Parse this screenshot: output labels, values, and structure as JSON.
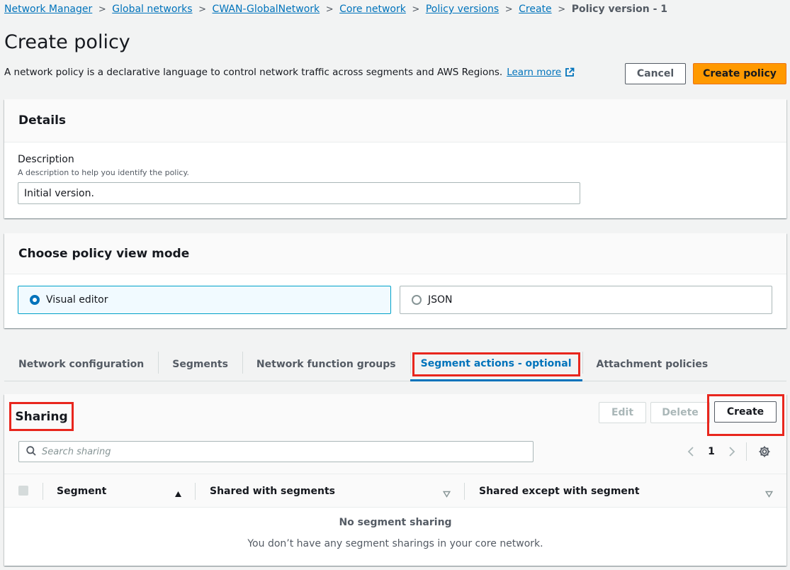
{
  "breadcrumb": {
    "items": [
      "Network Manager",
      "Global networks",
      "CWAN-GlobalNetwork",
      "Core network",
      "Policy versions",
      "Create"
    ],
    "current": "Policy version - 1"
  },
  "header": {
    "title": "Create policy",
    "description": "A network policy is a declarative language to control network traffic across segments and AWS Regions.",
    "learn_more": "Learn more",
    "cancel_label": "Cancel",
    "create_label": "Create policy"
  },
  "details": {
    "title": "Details",
    "description_label": "Description",
    "description_hint": "A description to help you identify the policy.",
    "description_value": "Initial version."
  },
  "view_mode": {
    "title": "Choose policy view mode",
    "options": [
      {
        "label": "Visual editor",
        "selected": true
      },
      {
        "label": "JSON",
        "selected": false
      }
    ]
  },
  "tabs": [
    {
      "label": "Network configuration",
      "active": false
    },
    {
      "label": "Segments",
      "active": false
    },
    {
      "label": "Network function groups",
      "active": false
    },
    {
      "label": "Segment actions - optional",
      "active": true
    },
    {
      "label": "Attachment policies",
      "active": false
    }
  ],
  "sharing": {
    "title": "Sharing",
    "edit_label": "Edit",
    "delete_label": "Delete",
    "create_label": "Create",
    "search_placeholder": "Search sharing",
    "page_number": "1",
    "columns": [
      "Segment",
      "Shared with segments",
      "Shared except with segment"
    ],
    "empty_title": "No segment sharing",
    "empty_description": "You don’t have any segment sharings in your core network."
  },
  "colors": {
    "link": "#0073bb",
    "primary": "#ff9900",
    "highlight": "#e8261d"
  }
}
